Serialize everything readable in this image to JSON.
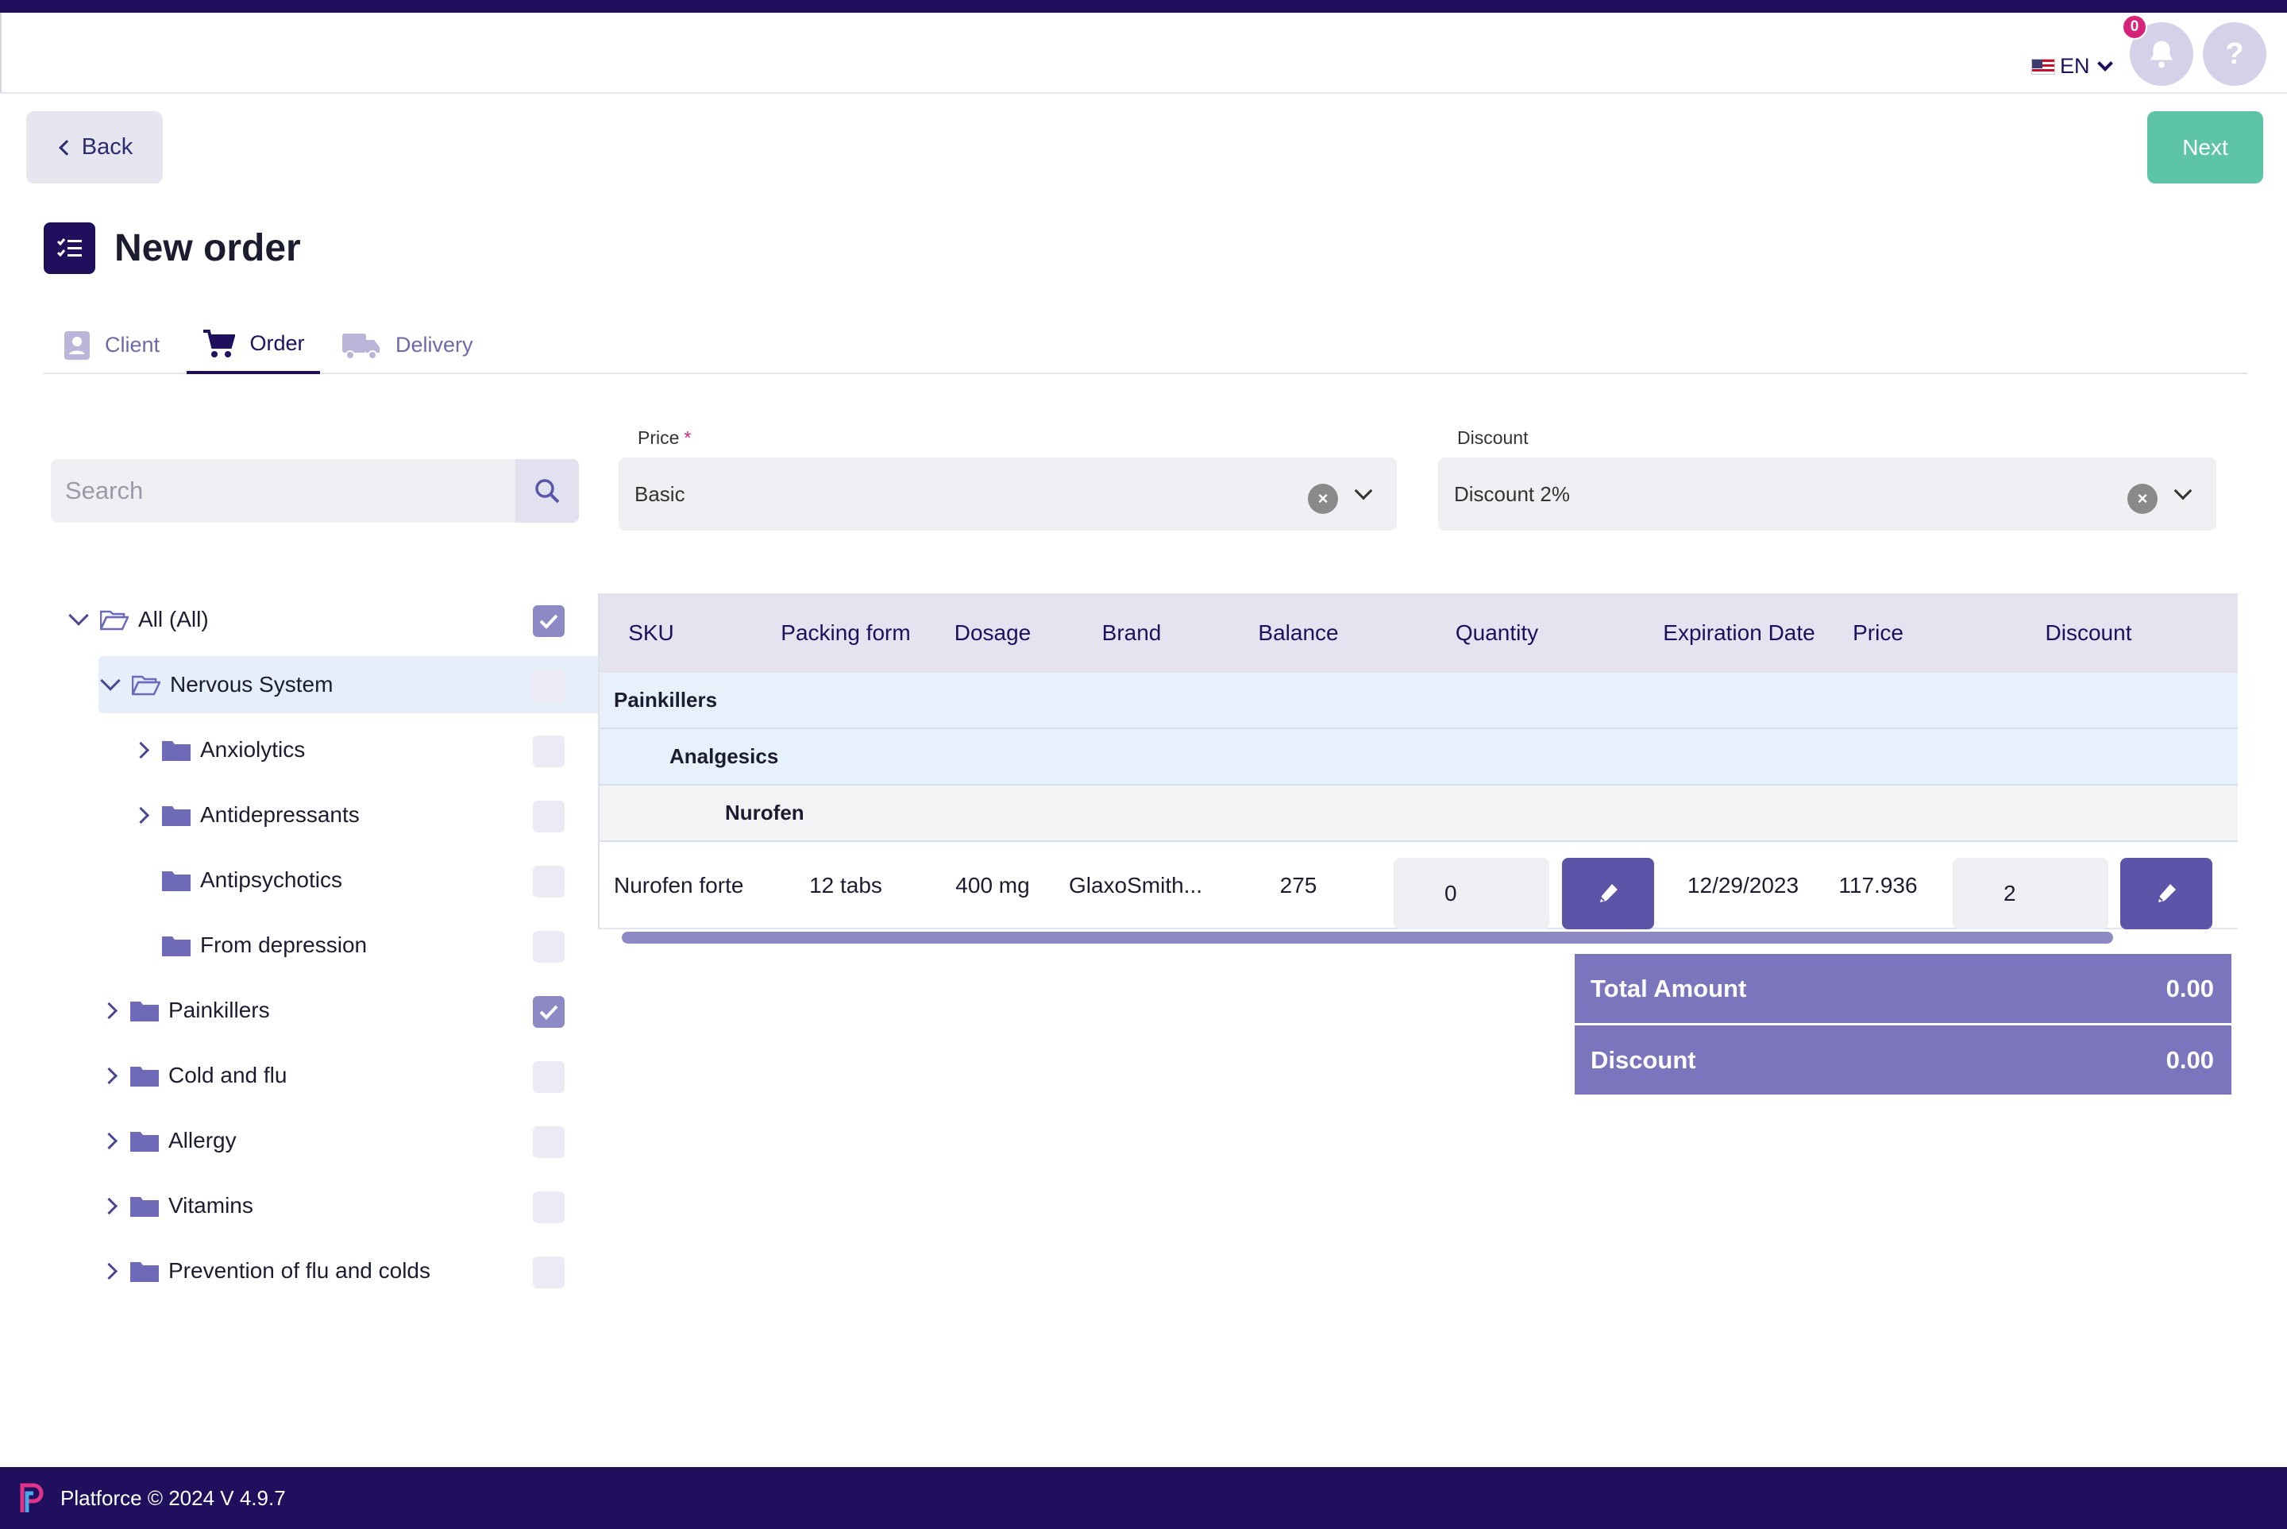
{
  "header": {
    "language": "EN",
    "notification_count": "0",
    "help_symbol": "?"
  },
  "toolbar": {
    "back_label": "Back",
    "next_label": "Next"
  },
  "page": {
    "title": "New order"
  },
  "tabs": [
    {
      "label": "Client",
      "icon": "contact-card-icon",
      "active": false
    },
    {
      "label": "Order",
      "icon": "shopping-cart-icon",
      "active": true
    },
    {
      "label": "Delivery",
      "icon": "truck-icon",
      "active": false
    }
  ],
  "search": {
    "placeholder": "Search",
    "value": ""
  },
  "filters": {
    "price_label": "Price",
    "price_required_mark": "*",
    "price_value": "Basic",
    "discount_label": "Discount",
    "discount_value": "Discount 2%"
  },
  "tree": [
    {
      "label": "All (All)",
      "expanded": true,
      "checked": true
    },
    {
      "label": "Nervous System",
      "expanded": true,
      "checked": false,
      "selected": true
    },
    {
      "label": "Anxiolytics",
      "expanded": false,
      "checked": false
    },
    {
      "label": "Antidepressants",
      "expanded": false,
      "checked": false
    },
    {
      "label": "Antipsychotics",
      "checked": false
    },
    {
      "label": "From depression",
      "checked": false
    },
    {
      "label": "Painkillers",
      "expanded": false,
      "checked": true
    },
    {
      "label": "Cold and flu",
      "expanded": false,
      "checked": false
    },
    {
      "label": "Allergy",
      "expanded": false,
      "checked": false
    },
    {
      "label": "Vitamins",
      "expanded": false,
      "checked": false
    },
    {
      "label": "Prevention of flu and colds",
      "expanded": false,
      "checked": false
    }
  ],
  "grid": {
    "columns": [
      "SKU",
      "Packing form",
      "Dosage",
      "Brand",
      "Balance",
      "Quantity",
      "Expiration Date",
      "Price",
      "Discount"
    ],
    "groups": [
      "Painkillers",
      "Analgesics",
      "Nurofen"
    ],
    "row": {
      "sku": "Nurofen forte",
      "packing_form": "12 tabs",
      "dosage": "400 mg",
      "brand": "GlaxoSmith...",
      "balance": "275",
      "quantity": "0",
      "expiration_date": "12/29/2023",
      "price": "117.936",
      "discount": "2"
    }
  },
  "totals": {
    "total_amount_label": "Total Amount",
    "total_amount_value": "0.00",
    "discount_label": "Discount",
    "discount_value": "0.00"
  },
  "footer": {
    "text": "Platforce © 2024 V 4.9.7"
  },
  "colors": {
    "primary": "#1f0f5c",
    "accent": "#5c54a8",
    "success": "#5ec4a8",
    "badge": "#d6247b",
    "totals_bg": "#7a75bc"
  }
}
